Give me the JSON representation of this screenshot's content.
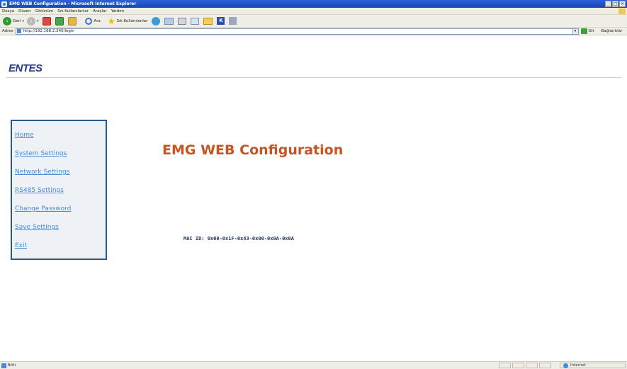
{
  "window": {
    "title": "EMG WEB Configuration - Microsoft Internet Explorer",
    "controls": {
      "minimize": "_",
      "maximize": "□",
      "close": "×"
    }
  },
  "menu": {
    "items": [
      "Dosya",
      "Düzen",
      "Görünüm",
      "Sık Kullanılanlar",
      "Araçlar",
      "Yardım"
    ]
  },
  "toolbar": {
    "back_label": "Geri",
    "search_label": "Ara",
    "favorites_label": "Sık Kullanılanlar",
    "icons": [
      "back-icon",
      "forward-icon",
      "stop-icon",
      "refresh-icon",
      "home-icon",
      "search-icon",
      "favorites-star-icon",
      "media-icon",
      "mail-icon",
      "print-icon",
      "edit-icon",
      "folder-icon",
      "messenger-icon"
    ]
  },
  "address": {
    "label": "Adres",
    "url": "http://192.168.2.240/login",
    "go_label": "Git",
    "links_label": "Bağlantılar"
  },
  "page": {
    "logo": "ENTES",
    "title": "EMG WEB Configuration",
    "mac_id": "MAC ID: 0x00-0x1F-0x43-0x00-0x0A-0x0A",
    "nav": [
      {
        "label": "Home"
      },
      {
        "label": "System Settings"
      },
      {
        "label": "Network Settings"
      },
      {
        "label": "RS485 Settings"
      },
      {
        "label": "Change Password"
      },
      {
        "label": "Save Settings"
      },
      {
        "label": "Exit"
      }
    ]
  },
  "status": {
    "text": "Bitti",
    "zone": "Internet"
  },
  "colors": {
    "title_bar": "#1a45b5",
    "page_title": "#c8541f",
    "nav_link": "#4a8ad6",
    "nav_border": "#2b5a8a",
    "logo": "#1f3f88"
  }
}
